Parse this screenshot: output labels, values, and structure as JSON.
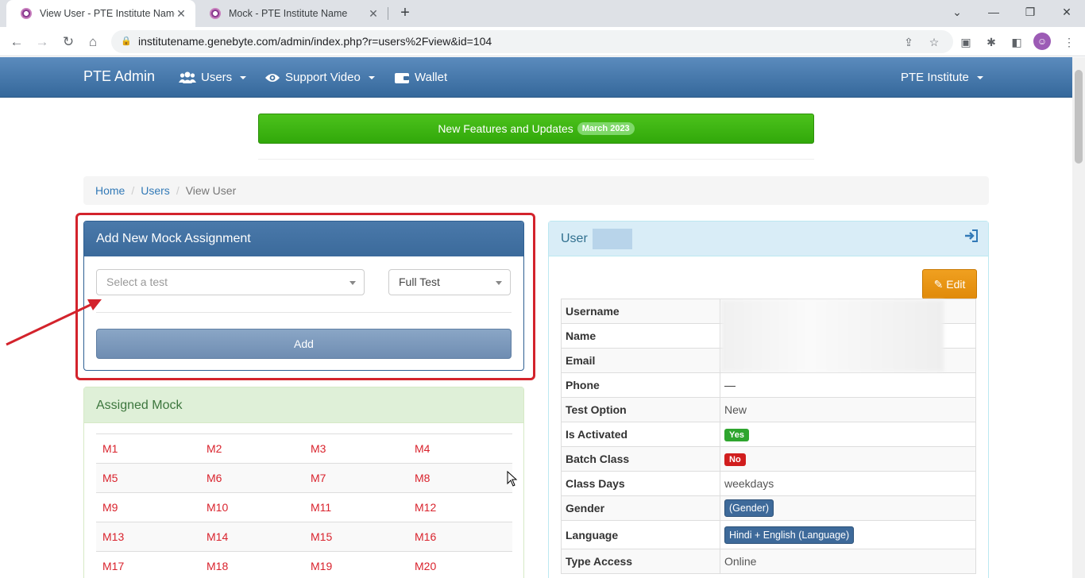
{
  "browser": {
    "tabs": [
      {
        "title": "View User - PTE Institute Name",
        "active": true
      },
      {
        "title": "Mock - PTE Institute Name",
        "active": false
      }
    ],
    "url": "institutename.genebyte.com/admin/index.php?r=users%2Fview&id=104"
  },
  "navbar": {
    "brand": "PTE Admin",
    "items": [
      {
        "label": "Users",
        "icon": "users-icon",
        "dropdown": true
      },
      {
        "label": "Support Video",
        "icon": "eye-icon",
        "dropdown": true
      },
      {
        "label": "Wallet",
        "icon": "wallet-icon",
        "dropdown": false
      }
    ],
    "right_menu": "PTE Institute"
  },
  "banner": {
    "text": "New Features and Updates",
    "badge": "March 2023"
  },
  "breadcrumb": {
    "home": "Home",
    "users": "Users",
    "current": "View User"
  },
  "mock_form": {
    "title": "Add New Mock Assignment",
    "test_placeholder": "Select a test",
    "type_value": "Full Test",
    "add_label": "Add"
  },
  "assigned": {
    "title": "Assigned Mock",
    "rows": [
      [
        "M1",
        "M2",
        "M3",
        "M4"
      ],
      [
        "M5",
        "M6",
        "M7",
        "M8"
      ],
      [
        "M9",
        "M10",
        "M11",
        "M12"
      ],
      [
        "M13",
        "M14",
        "M15",
        "M16"
      ],
      [
        "M17",
        "M18",
        "M19",
        "M20"
      ]
    ]
  },
  "user": {
    "title": "User",
    "edit_label": "Edit",
    "fields": [
      {
        "key": "Username",
        "value": ""
      },
      {
        "key": "Name",
        "value": ""
      },
      {
        "key": "Email",
        "value": ""
      },
      {
        "key": "Phone",
        "value": "—"
      },
      {
        "key": "Test Option",
        "value": "New"
      },
      {
        "key": "Is Activated",
        "value": "Yes",
        "badge": "ok"
      },
      {
        "key": "Batch Class",
        "value": "No",
        "badge": "no"
      },
      {
        "key": "Class Days",
        "value": "weekdays"
      },
      {
        "key": "Gender",
        "value": "(Gender)",
        "badge": "info"
      },
      {
        "key": "Language",
        "value": "Hindi + English (Language)",
        "badge": "info"
      },
      {
        "key": "Type Access",
        "value": "Online"
      }
    ]
  },
  "colors": {
    "navbar": "#3b6c9e",
    "banner": "#3cb514",
    "mock_link": "#d9232d",
    "highlight": "#d3232c"
  }
}
